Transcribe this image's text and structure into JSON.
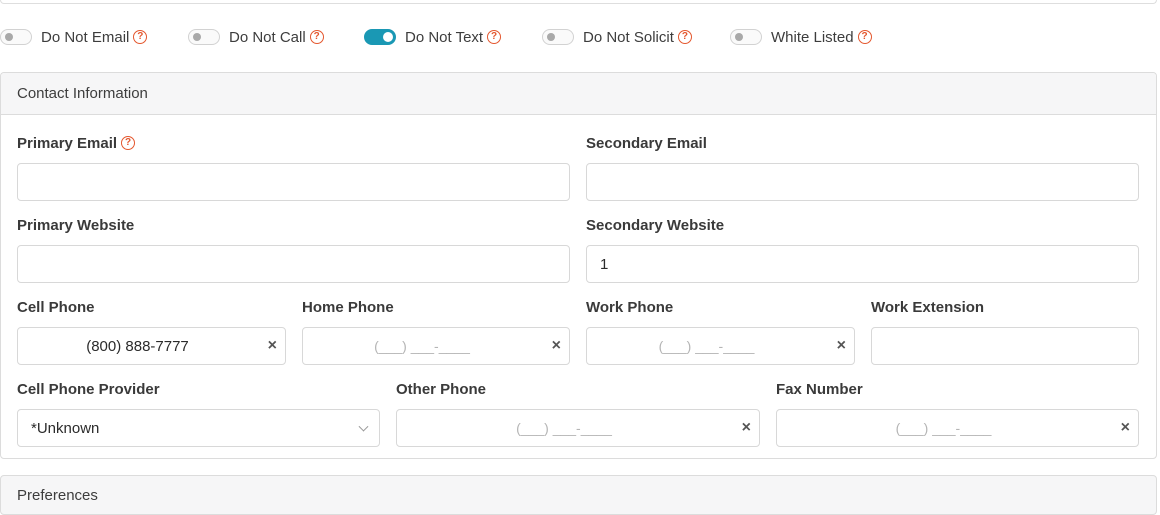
{
  "toggles": [
    {
      "label": "Do Not Email",
      "on": false
    },
    {
      "label": "Do Not Call",
      "on": false
    },
    {
      "label": "Do Not Text",
      "on": true
    },
    {
      "label": "Do Not Solicit",
      "on": false
    },
    {
      "label": "White Listed",
      "on": false
    }
  ],
  "contact": {
    "title": "Contact Information",
    "primary_email": {
      "label": "Primary Email",
      "value": ""
    },
    "secondary_email": {
      "label": "Secondary Email",
      "value": ""
    },
    "primary_website": {
      "label": "Primary Website",
      "value": ""
    },
    "secondary_website": {
      "label": "Secondary Website",
      "value": "1"
    },
    "cell_phone": {
      "label": "Cell Phone",
      "value": "(800) 888-7777"
    },
    "home_phone": {
      "label": "Home Phone",
      "mask": "(___) ___-____"
    },
    "work_phone": {
      "label": "Work Phone",
      "mask": "(___) ___-____"
    },
    "work_extension": {
      "label": "Work Extension",
      "value": ""
    },
    "cell_provider": {
      "label": "Cell Phone Provider",
      "value": "*Unknown"
    },
    "other_phone": {
      "label": "Other Phone",
      "mask": "(___) ___-____"
    },
    "fax_number": {
      "label": "Fax Number",
      "mask": "(___) ___-____"
    }
  },
  "preferences": {
    "title": "Preferences"
  },
  "icons": {
    "help": "question-circle-icon",
    "clear": "close-icon",
    "select": "chevron-down-icon"
  },
  "colors": {
    "accent": "#1a98b4",
    "help": "#e4572e"
  }
}
